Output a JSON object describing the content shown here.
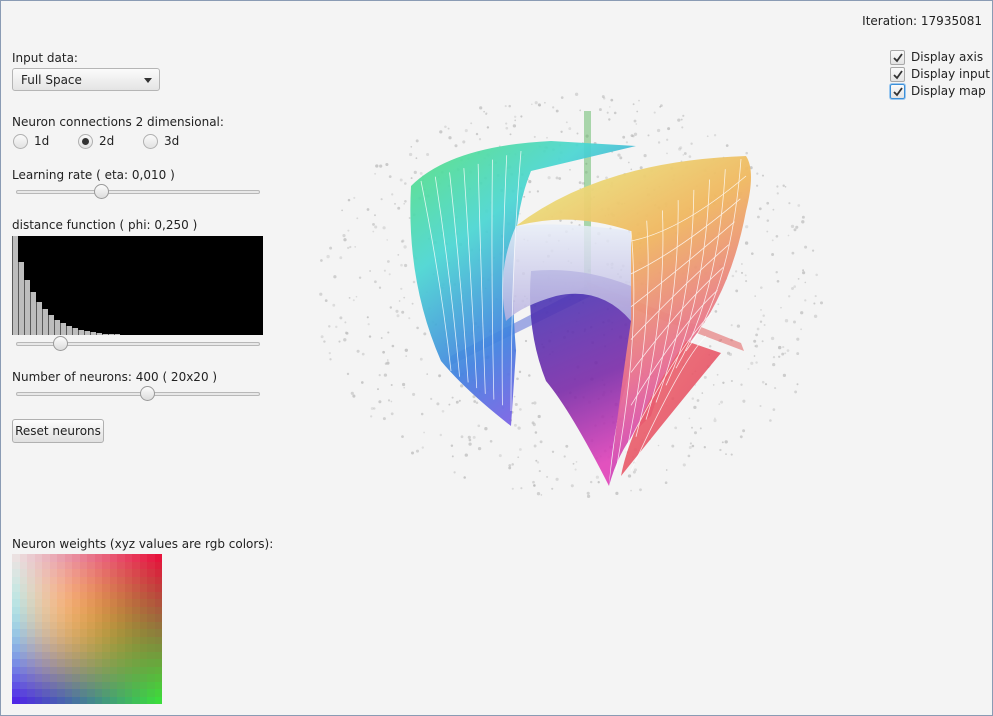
{
  "header": {
    "iteration_label": "Iteration: 17935081"
  },
  "controls": {
    "input_data_label": "Input data:",
    "input_data_value": "Full Space",
    "connections_label": "Neuron connections 2 dimensional:",
    "connections_options": [
      {
        "label": "1d",
        "selected": false
      },
      {
        "label": "2d",
        "selected": true
      },
      {
        "label": "3d",
        "selected": false
      }
    ],
    "learning_rate_label": "Learning rate ( eta: 0,010 )",
    "learning_rate_fraction": 0.34,
    "distance_label": "distance function ( phi: 0,250 )",
    "distance_fraction": 0.16,
    "distance_histogram": [
      1.0,
      0.74,
      0.56,
      0.43,
      0.33,
      0.26,
      0.2,
      0.15,
      0.12,
      0.09,
      0.07,
      0.055,
      0.04,
      0.03,
      0.02,
      0.014,
      0.01,
      0.006
    ],
    "neurons_label": "Number of neurons: 400 ( 20x20 )",
    "neurons_fraction": 0.54,
    "reset_label": "Reset neurons"
  },
  "display_options": [
    {
      "label": "Display axis",
      "checked": true
    },
    {
      "label": "Display input",
      "checked": true
    },
    {
      "label": "Display map",
      "checked": true
    }
  ],
  "weights": {
    "label": "Neuron weights (xyz values are rgb colors):",
    "grid": [
      20,
      20
    ]
  },
  "colors": {
    "accent": "#3c8fd8",
    "axis_red": "#e0504f",
    "axis_green": "#4caf50",
    "axis_blue": "#3a4fd0"
  }
}
